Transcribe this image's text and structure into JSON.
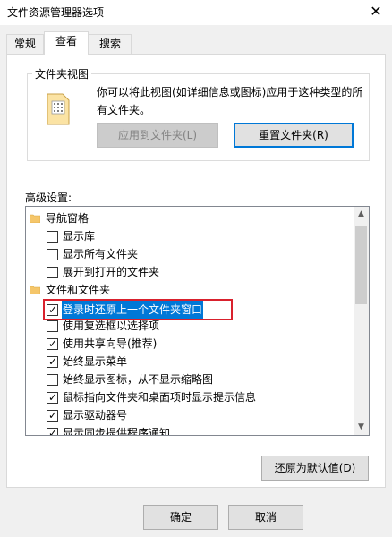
{
  "window": {
    "title": "文件资源管理器选项",
    "close_glyph": "✕"
  },
  "tabs": [
    {
      "label": "常规",
      "active": false
    },
    {
      "label": "查看",
      "active": true
    },
    {
      "label": "搜索",
      "active": false
    }
  ],
  "folder_view": {
    "group_label": "文件夹视图",
    "description": "你可以将此视图(如详细信息或图标)应用于这种类型的所有文件夹。",
    "apply_button": "应用到文件夹(L)",
    "reset_button": "重置文件夹(R)"
  },
  "advanced": {
    "label": "高级设置:",
    "items": [
      {
        "type": "folder",
        "label": "导航窗格"
      },
      {
        "type": "checkbox",
        "label": "显示库",
        "checked": false
      },
      {
        "type": "checkbox",
        "label": "显示所有文件夹",
        "checked": false
      },
      {
        "type": "checkbox",
        "label": "展开到打开的文件夹",
        "checked": false
      },
      {
        "type": "folder",
        "label": "文件和文件夹"
      },
      {
        "type": "checkbox",
        "label": "登录时还原上一个文件夹窗口",
        "checked": true,
        "selected": true
      },
      {
        "type": "checkbox",
        "label": "使用复选框以选择项",
        "checked": false
      },
      {
        "type": "checkbox",
        "label": "使用共享向导(推荐)",
        "checked": true
      },
      {
        "type": "checkbox",
        "label": "始终显示菜单",
        "checked": true
      },
      {
        "type": "checkbox",
        "label": "始终显示图标，从不显示缩略图",
        "checked": false
      },
      {
        "type": "checkbox",
        "label": "鼠标指向文件夹和桌面项时显示提示信息",
        "checked": true
      },
      {
        "type": "checkbox",
        "label": "显示驱动器号",
        "checked": true
      },
      {
        "type": "checkbox",
        "label": "显示同步提供程序通知",
        "checked": true
      }
    ],
    "restore_default_button": "还原为默认值(D)"
  },
  "footer": {
    "ok_button": "确定",
    "cancel_button": "取消"
  },
  "colors": {
    "accent": "#0078d7",
    "highlight_border": "#d9212d",
    "folder": "#f5c66a"
  }
}
